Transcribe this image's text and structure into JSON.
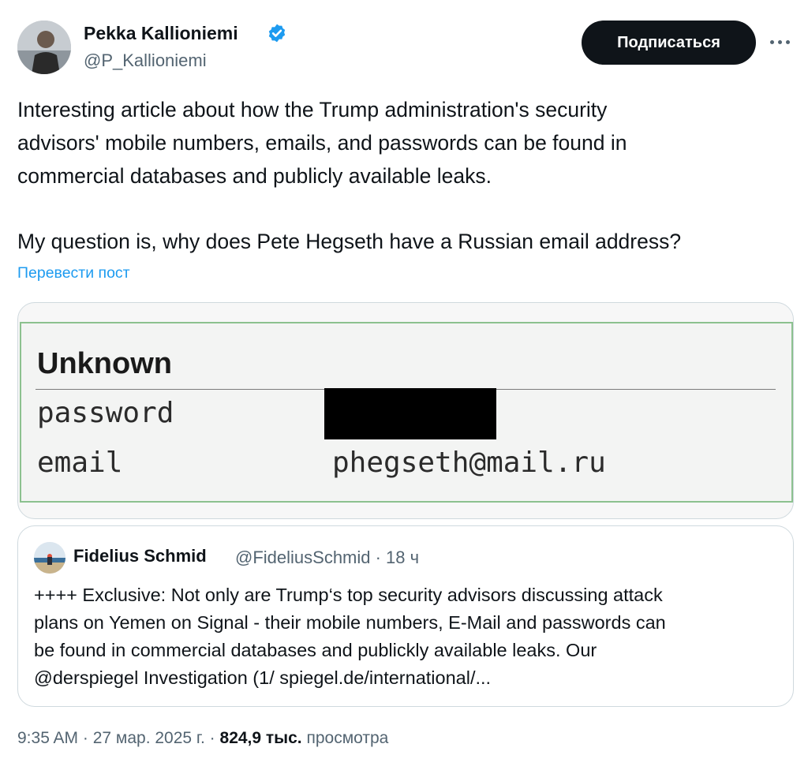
{
  "author": {
    "name": "Pekka Kallioniemi",
    "handle": "@P_Kallioniemi"
  },
  "follow_button_label": "Подписаться",
  "tweet": {
    "lines": [
      "Interesting article about how the Trump administration's security",
      "advisors' mobile numbers, emails, and passwords can be found in",
      "commercial databases and publicly available leaks.",
      "My question is, why does Pete Hegseth have a Russian email address?"
    ],
    "translate_label": "Перевести пост"
  },
  "media": {
    "heading": "Unknown",
    "rows": [
      {
        "label": "password",
        "value": ""
      },
      {
        "label": "email",
        "value": "phegseth@mail.ru"
      }
    ]
  },
  "quote": {
    "author_name": "Fidelius Schmid",
    "meta": "@FideliusSchmid · 18 ч",
    "lines": [
      "++++ Exclusive: Not only are Trump‘s top security advisors discussing attack",
      "plans on Yemen on Signal - their mobile numbers, E-Mail and passwords can",
      "be found in commercial databases and publickly available leaks. Our",
      "@derspiegel Investigation (1/ spiegel.de/international/..."
    ]
  },
  "footer": {
    "time_date": "9:35 AM · 27 мар. 2025 г. · ",
    "views_count": "824,9 тыс.",
    "views_label": " просмотра"
  },
  "icons": {
    "verified": "verified-badge-icon",
    "more": "more-horizontal-icon"
  },
  "colors": {
    "accent": "#1d9bf0",
    "text": "#0f1419",
    "secondary": "#536471",
    "follow_bg": "#0f1419",
    "media_border": "#8cc18f"
  }
}
